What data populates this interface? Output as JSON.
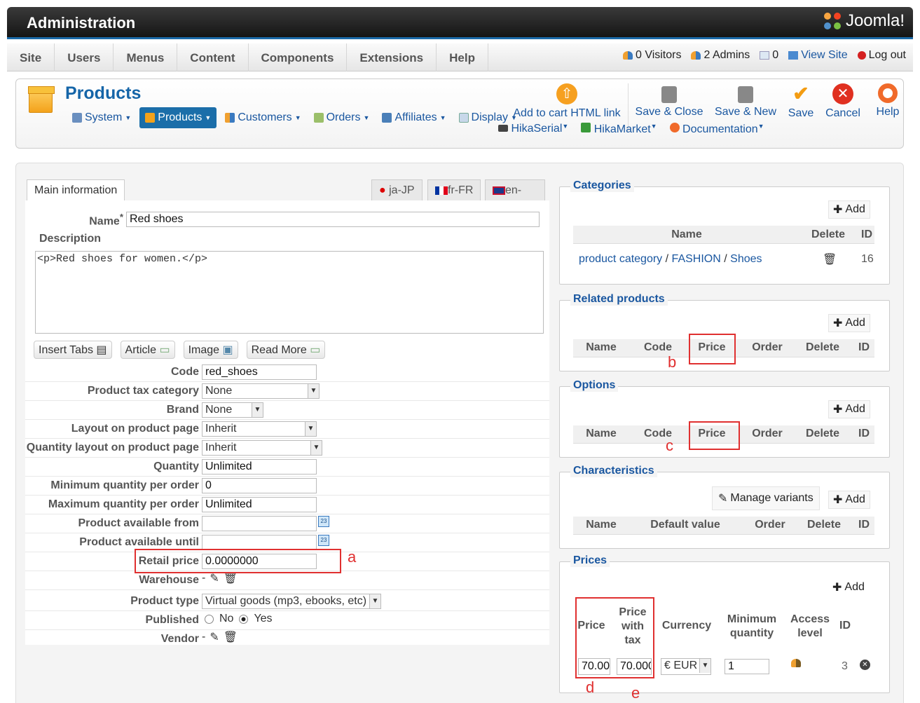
{
  "header": {
    "title": "Administration",
    "logo_text": "Joomla!"
  },
  "menu": [
    {
      "label": "Site"
    },
    {
      "label": "Users"
    },
    {
      "label": "Menus"
    },
    {
      "label": "Content"
    },
    {
      "label": "Components"
    },
    {
      "label": "Extensions"
    },
    {
      "label": "Help"
    }
  ],
  "status": {
    "visitors": "0 Visitors",
    "admins": "2 Admins",
    "messages": "0",
    "view_site": "View Site",
    "logout": "Log out"
  },
  "toolbar": {
    "page_title": "Products",
    "submenu": [
      {
        "label": "System"
      },
      {
        "label": "Products",
        "active": true
      },
      {
        "label": "Customers"
      },
      {
        "label": "Orders"
      },
      {
        "label": "Affiliates"
      },
      {
        "label": "Display"
      }
    ],
    "add_to_cart": "Add to cart HTML link",
    "save_close": "Save & Close",
    "save_new": "Save & New",
    "save": "Save",
    "cancel": "Cancel",
    "help": "Help",
    "row2": [
      {
        "label": "HikaSerial"
      },
      {
        "label": "HikaMarket"
      },
      {
        "label": "Documentation"
      }
    ]
  },
  "tabs": {
    "main": "Main information",
    "langs": [
      "ja-JP",
      "fr-FR",
      "en-GB"
    ]
  },
  "form": {
    "name_label": "Name",
    "name_value": "Red shoes",
    "description_label": "Description",
    "description_value": "<p>Red shoes for women.</p>",
    "editor_buttons": [
      "Insert Tabs",
      "Article",
      "Image",
      "Read More"
    ],
    "code_label": "Code",
    "code_value": "red_shoes",
    "tax_label": "Product tax category",
    "tax_value": "None",
    "brand_label": "Brand",
    "brand_value": "None",
    "layout_label": "Layout on product page",
    "layout_value": "Inherit",
    "qty_layout_label": "Quantity layout on product page",
    "qty_layout_value": "Inherit",
    "quantity_label": "Quantity",
    "quantity_value": "Unlimited",
    "min_qty_label": "Minimum quantity per order",
    "min_qty_value": "0",
    "max_qty_label": "Maximum quantity per order",
    "max_qty_value": "Unlimited",
    "avail_from_label": "Product available from",
    "avail_until_label": "Product available until",
    "calendar_day": "23",
    "retail_label": "Retail price",
    "retail_value": "0.0000000",
    "warehouse_label": "Warehouse",
    "warehouse_value": "-",
    "ptype_label": "Product type",
    "ptype_value": "Virtual goods (mp3, ebooks, etc)",
    "published_label": "Published",
    "published_no": "No",
    "published_yes": "Yes",
    "vendor_label": "Vendor",
    "vendor_value": "-"
  },
  "categories": {
    "title": "Categories",
    "add": "Add",
    "col_name": "Name",
    "col_delete": "Delete",
    "col_id": "ID",
    "path": [
      "product category",
      "FASHION",
      "Shoes"
    ],
    "sep": "/",
    "id": "16"
  },
  "related": {
    "title": "Related products",
    "add": "Add",
    "cols": [
      "Name",
      "Code",
      "Price",
      "Order",
      "Delete",
      "ID"
    ]
  },
  "options": {
    "title": "Options",
    "add": "Add",
    "cols": [
      "Name",
      "Code",
      "Price",
      "Order",
      "Delete",
      "ID"
    ]
  },
  "characteristics": {
    "title": "Characteristics",
    "manage": "Manage variants",
    "add": "Add",
    "cols": [
      "Name",
      "Default value",
      "Order",
      "Delete",
      "ID"
    ]
  },
  "prices": {
    "title": "Prices",
    "add": "Add",
    "col_price": "Price",
    "col_price_tax": "Price with tax",
    "col_currency": "Currency",
    "col_min": "Minimum quantity",
    "col_access": "Access level",
    "col_id": "ID",
    "row": {
      "price": "70.00",
      "price_tax": "70.000",
      "currency": "€ EUR",
      "min": "1",
      "id": "3"
    }
  },
  "annotations": {
    "a": "a",
    "b": "b",
    "c": "c",
    "d": "d",
    "e": "e"
  },
  "colors": {
    "accent": "#1565a8",
    "annotation": "#e03030"
  }
}
